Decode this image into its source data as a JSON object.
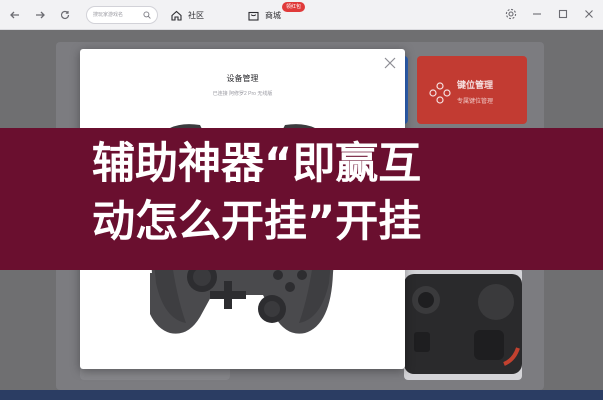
{
  "search": {
    "placeholder": "搜玩家游戏名"
  },
  "nav": {
    "community_label": "社区",
    "store_label": "商城",
    "store_badge": "领红包"
  },
  "background": {
    "tile_title": "键位管理",
    "tile_subtitle": "专属键位管理"
  },
  "modal": {
    "title": "设备管理",
    "subtitle": "已连接 阿修罗2 Pro 无线版"
  },
  "headline": {
    "line1": "辅助神器“即赢互",
    "line2": "动怎么开挂”开挂"
  },
  "colors": {
    "banner": "#6a0f2f",
    "accent_red": "#c23b32",
    "accent_blue": "#2f63b8",
    "badge": "#e03a3a"
  }
}
